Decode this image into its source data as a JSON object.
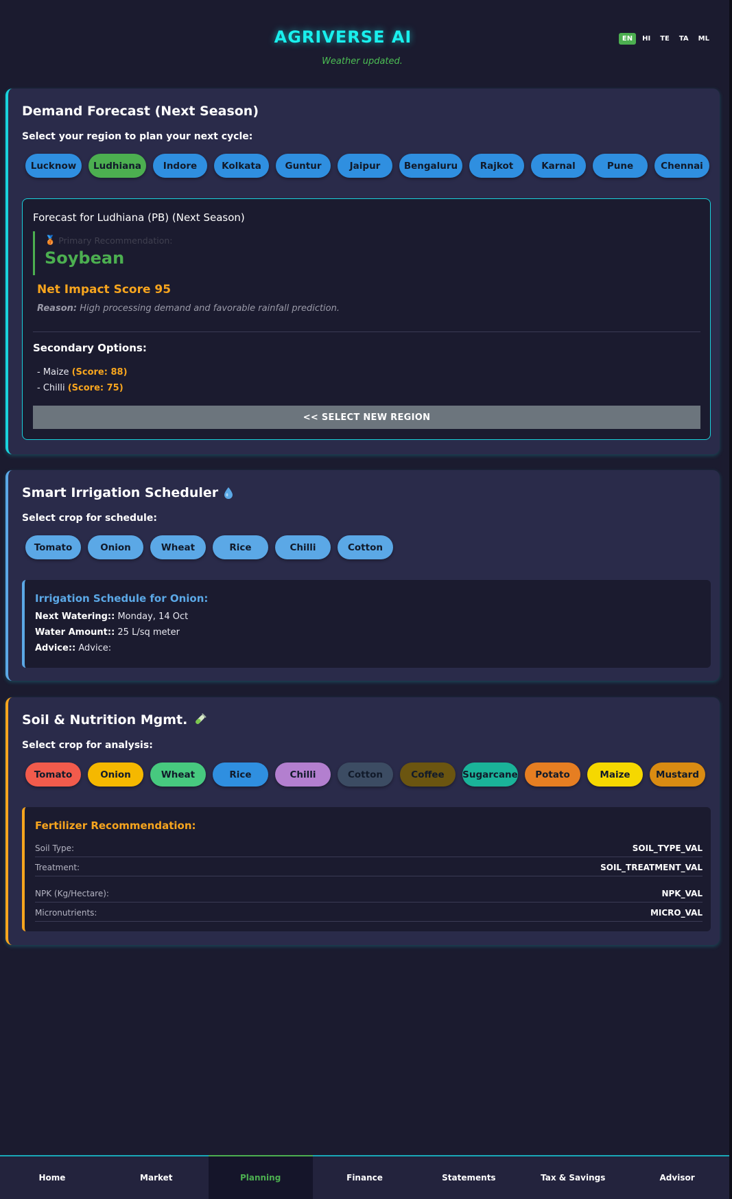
{
  "header": {
    "brand": "AGRIVERSE AI",
    "status": "Weather updated.",
    "languages": [
      "EN",
      "HI",
      "TE",
      "TA",
      "ML"
    ],
    "active_language": "EN"
  },
  "forecast": {
    "title": "Demand Forecast (Next Season)",
    "prompt": "Select your region to plan your next cycle:",
    "regions": [
      "Lucknow",
      "Ludhiana",
      "Indore",
      "Kolkata",
      "Guntur",
      "Jaipur",
      "Bengaluru",
      "Rajkot",
      "Karnal",
      "Pune",
      "Chennai"
    ],
    "selected_region": "Ludhiana",
    "result_title": "Forecast for Ludhiana (PB) (Next Season)",
    "primary_label": "Primary Recommendation:",
    "primary_crop": "Soybean",
    "impact": "Net Impact Score 95",
    "reason_label": "Reason:",
    "reason_text": "High processing demand and favorable rainfall prediction.",
    "secondary_title": "Secondary Options:",
    "secondary": [
      {
        "name": "- Maize ",
        "score": "(Score: 88)"
      },
      {
        "name": "- Chilli ",
        "score": "(Score: 75)"
      }
    ],
    "reset_label": "<< SELECT NEW REGION"
  },
  "irrigation": {
    "title": "Smart Irrigation Scheduler",
    "prompt": "Select crop for schedule:",
    "crops": [
      "Tomato",
      "Onion",
      "Wheat",
      "Rice",
      "Chilli",
      "Cotton"
    ],
    "schedule_title": "Irrigation Schedule for Onion:",
    "rows": [
      {
        "label": "Next Watering::",
        "value": " Monday, 14 Oct"
      },
      {
        "label": "Water Amount::",
        "value": " 25 L/sq meter"
      },
      {
        "label": "Advice::",
        "value": " Advice:"
      }
    ]
  },
  "soil": {
    "title": "Soil & Nutrition Mgmt.",
    "prompt": "Select crop for analysis:",
    "crops": [
      {
        "label": "Tomato",
        "color": "#f25b4c"
      },
      {
        "label": "Onion",
        "color": "#f5b800"
      },
      {
        "label": "Wheat",
        "color": "#47c97f"
      },
      {
        "label": "Rice",
        "color": "#2f8fe0"
      },
      {
        "label": "Chilli",
        "color": "#b37fcf"
      },
      {
        "label": "Cotton",
        "color": "#3c4c63"
      },
      {
        "label": "Coffee",
        "color": "#6b5510"
      },
      {
        "label": "Sugarcane",
        "color": "#1ab399"
      },
      {
        "label": "Potato",
        "color": "#e67e22"
      },
      {
        "label": "Maize",
        "color": "#f5d800"
      },
      {
        "label": "Mustard",
        "color": "#d98b12"
      }
    ],
    "fert_title": "Fertilizer Recommendation:",
    "rows": [
      {
        "key": "Soil Type:",
        "value": "SOIL_TYPE_VAL"
      },
      {
        "key": "Treatment:",
        "value": "SOIL_TREATMENT_VAL"
      },
      {
        "key": "NPK (Kg/Hectare):",
        "value": "NPK_VAL"
      },
      {
        "key": "Micronutrients:",
        "value": "MICRO_VAL"
      }
    ]
  },
  "nav": {
    "items": [
      "Home",
      "Market",
      "Planning",
      "Finance",
      "Statements",
      "Tax & Savings",
      "Advisor"
    ],
    "active": "Planning"
  },
  "colors": {
    "accent": "#19f0ee",
    "success": "#4caf50",
    "warning": "#f7a51e",
    "info": "#5ba8e6"
  }
}
